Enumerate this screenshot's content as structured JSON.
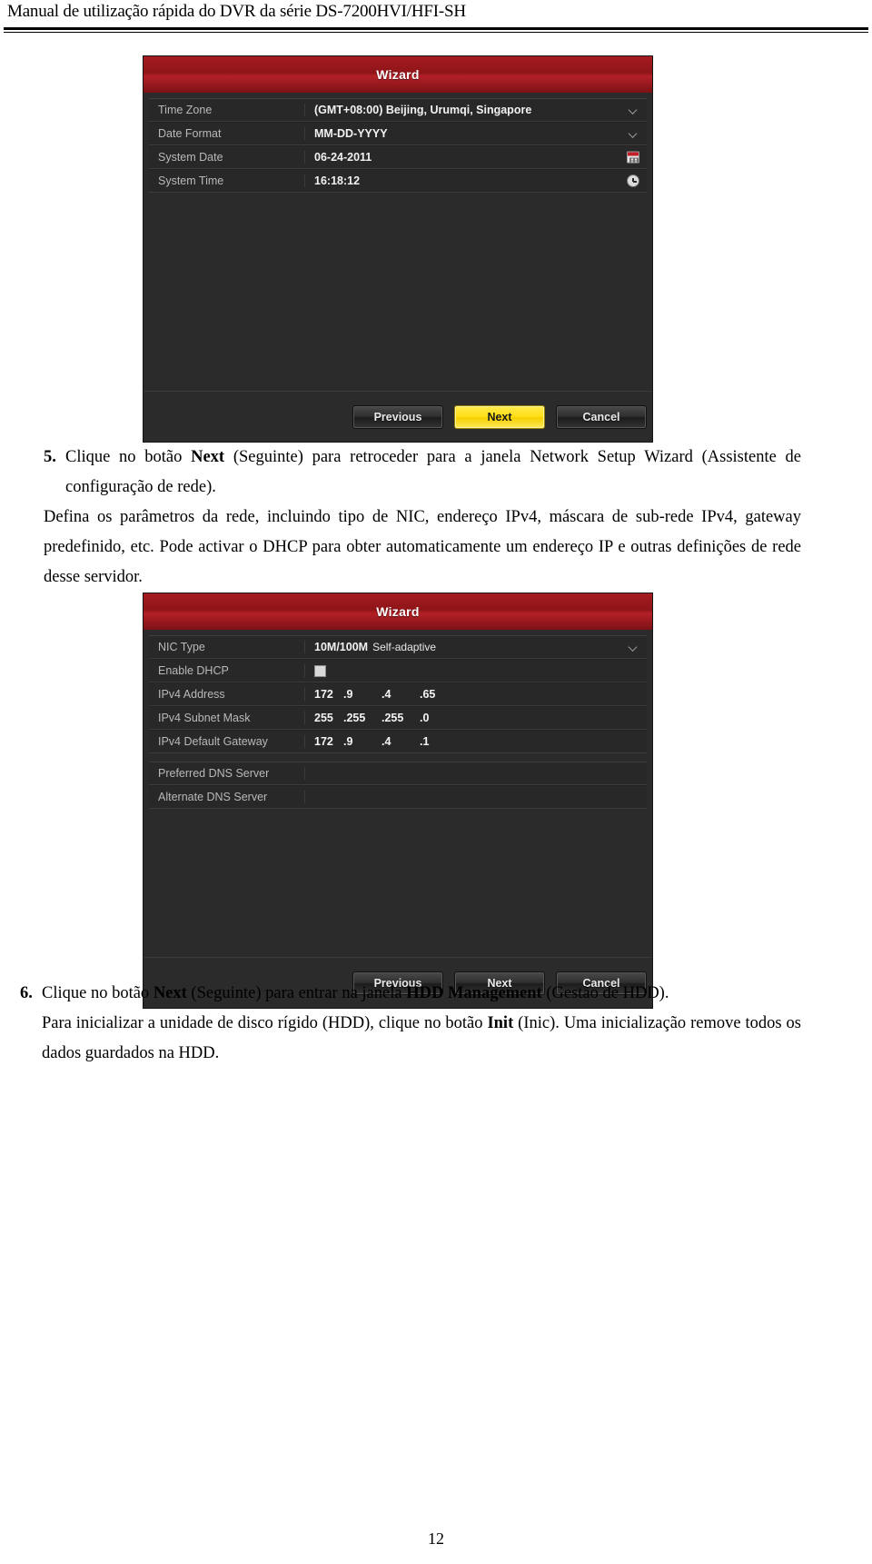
{
  "header": {
    "title": "Manual de utilização rápida do DVR da série DS-7200HVI/HFI-SH"
  },
  "wizard_time": {
    "title": "Wizard",
    "rows": [
      {
        "label": "Time Zone",
        "value": "(GMT+08:00) Beijing, Urumqi, Singapore",
        "control": "dropdown"
      },
      {
        "label": "Date Format",
        "value": "MM-DD-YYYY",
        "control": "dropdown"
      },
      {
        "label": "System Date",
        "value": "06-24-2011",
        "control": "calendar"
      },
      {
        "label": "System Time",
        "value": "16:18:12",
        "control": "clock"
      }
    ],
    "buttons": {
      "previous": "Previous",
      "next": "Next",
      "cancel": "Cancel"
    }
  },
  "step5": {
    "number": "5.",
    "line1_a": "Clique no botão ",
    "line1_b": "Next",
    "line1_c": " (Seguinte) para retroceder para a janela Network Setup Wizard (Assistente de configuração de rede).",
    "line2": "Defina os parâmetros da rede, incluindo tipo de NIC, endereço IPv4, máscara de sub-rede IPv4, gateway predefinido, etc. Pode activar o DHCP para obter automaticamente um endereço IP e outras definições de rede desse servidor."
  },
  "wizard_network": {
    "title": "Wizard",
    "rows": [
      {
        "label": "NIC Type",
        "value": "10M/100M",
        "value_sub": "Self-adaptive",
        "control": "dropdown"
      },
      {
        "label": "Enable DHCP",
        "value": "",
        "control": "checkbox",
        "checked": false
      },
      {
        "label": "IPv4 Address",
        "octets": [
          "172",
          ".9",
          ".4",
          ".65"
        ],
        "control": "ip"
      },
      {
        "label": "IPv4 Subnet Mask",
        "octets": [
          "255",
          ".255",
          ".255",
          ".0"
        ],
        "control": "ip"
      },
      {
        "label": "IPv4 Default Gateway",
        "octets": [
          "172",
          ".9",
          ".4",
          ".1"
        ],
        "control": "ip"
      }
    ],
    "rows2": [
      {
        "label": "Preferred DNS Server",
        "value": "",
        "control": "text"
      },
      {
        "label": "Alternate DNS Server",
        "value": "",
        "control": "text"
      }
    ],
    "buttons": {
      "previous": "Previous",
      "next": "Next",
      "cancel": "Cancel"
    }
  },
  "step6": {
    "number": "6.",
    "line1_a": "Clique no botão ",
    "line1_b": "Next",
    "line1_c": " (Seguinte) para entrar na janela ",
    "line1_d": "HDD Management",
    "line1_e": " (Gestão de HDD).",
    "line2_a": "Para inicializar a unidade de disco rígido (HDD), clique no botão ",
    "line2_b": "Init",
    "line2_c": " (Inic). Uma inicialização remove todos os dados guardados na HDD."
  },
  "footer": {
    "page_number": "12"
  },
  "colors": {
    "title_bar_red": "#a51b20",
    "primary_button_yellow": "#ffdf16",
    "dialog_bg": "#2b2b2b"
  }
}
